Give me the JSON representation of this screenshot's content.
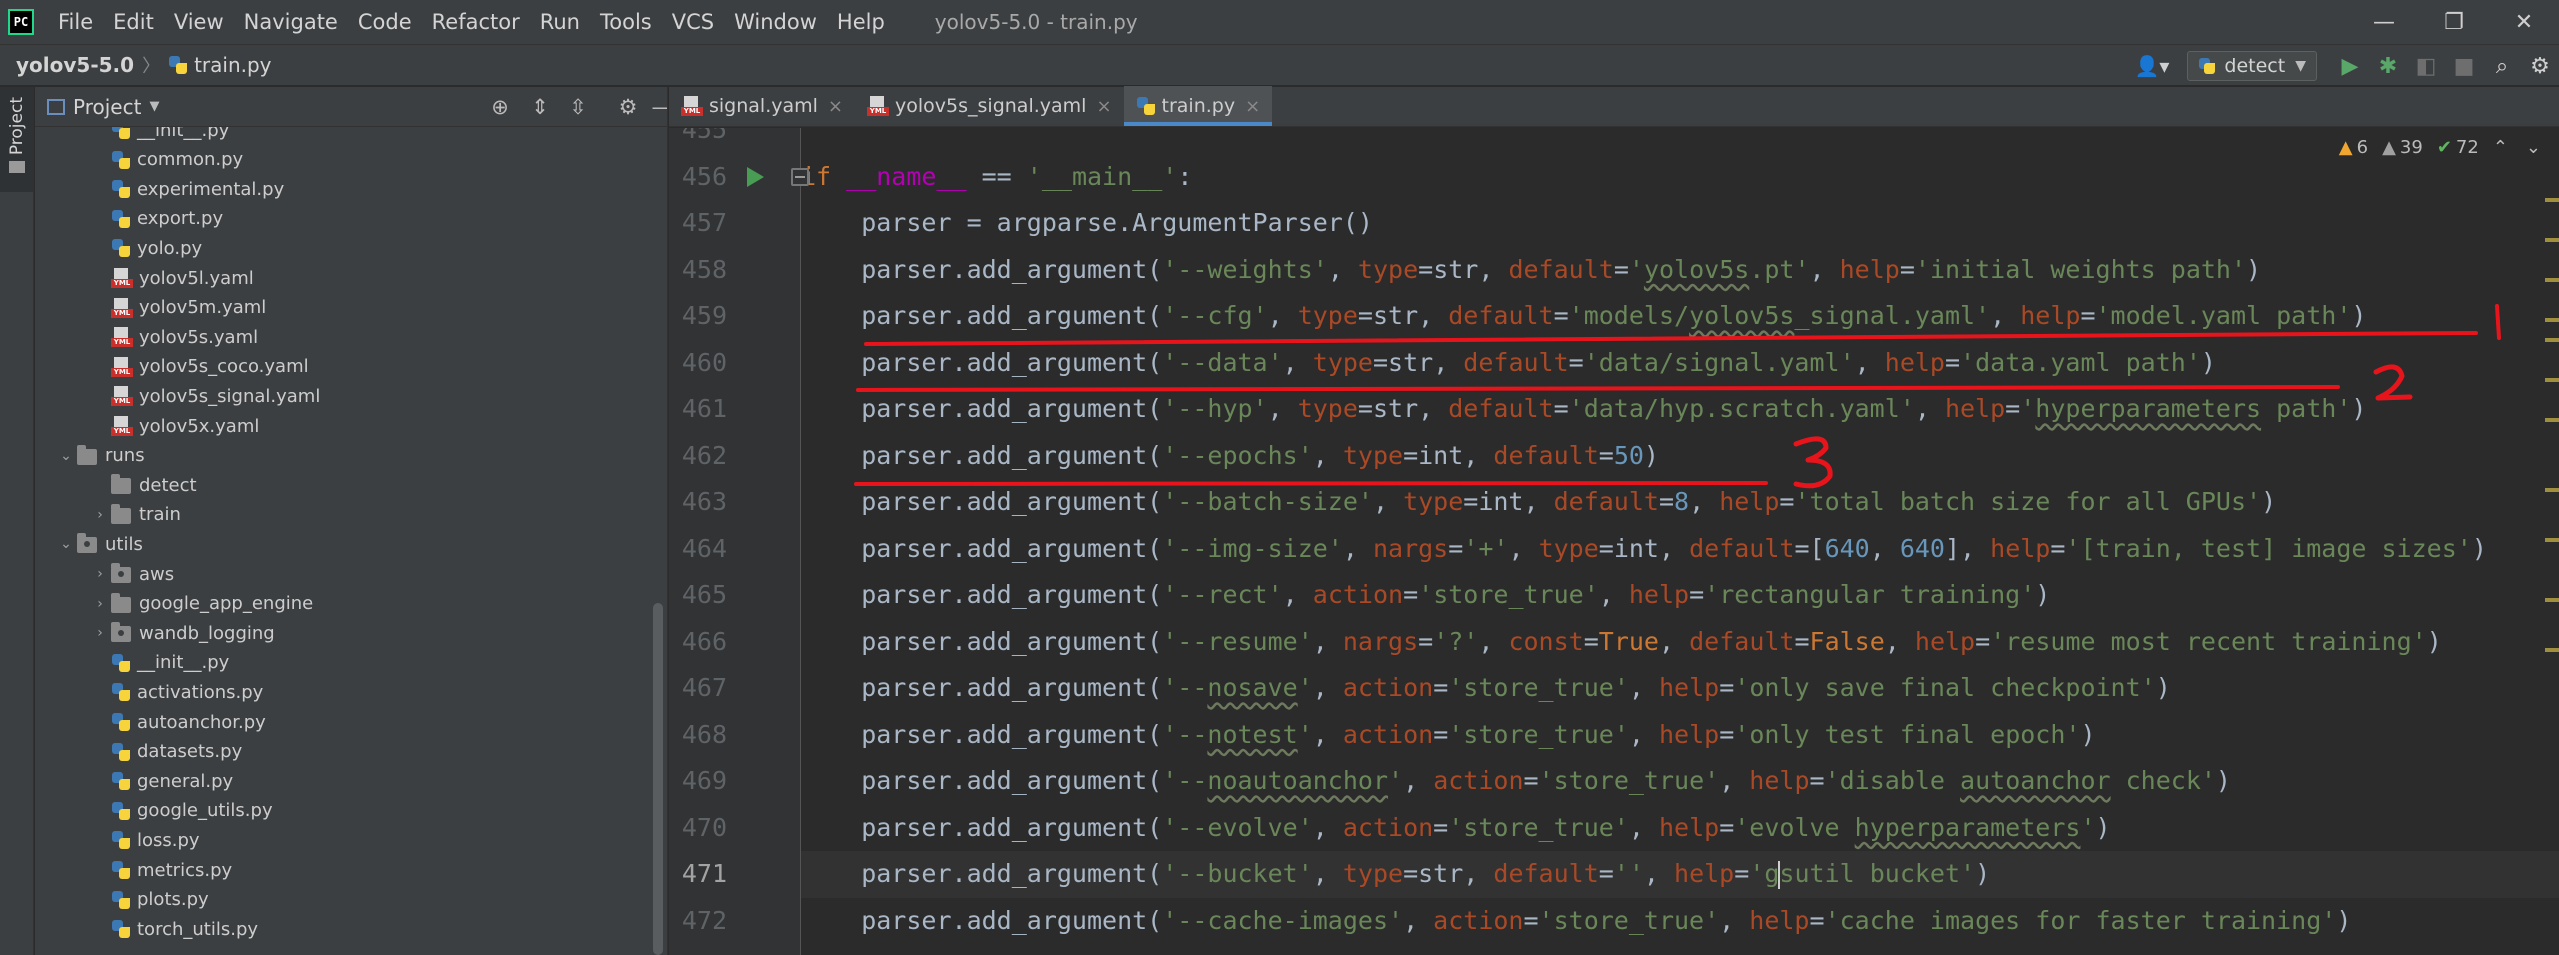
{
  "menubar": {
    "logo": "PC",
    "items": [
      "File",
      "Edit",
      "View",
      "Navigate",
      "Code",
      "Refactor",
      "Run",
      "Tools",
      "VCS",
      "Window",
      "Help"
    ],
    "window_title": "yolov5-5.0 - train.py",
    "minimize_icon": "minimize-icon",
    "maximize_icon": "maximize-icon",
    "close_icon": "close-icon"
  },
  "navbar": {
    "project": "yolov5-5.0",
    "file": "train.py",
    "run_config": "detect"
  },
  "project_panel": {
    "title": "Project",
    "tree": [
      {
        "label": "__init__.py",
        "type": "py",
        "depth": 2
      },
      {
        "label": "common.py",
        "type": "py",
        "depth": 2
      },
      {
        "label": "experimental.py",
        "type": "py",
        "depth": 2
      },
      {
        "label": "export.py",
        "type": "py",
        "depth": 2
      },
      {
        "label": "yolo.py",
        "type": "py",
        "depth": 2
      },
      {
        "label": "yolov5l.yaml",
        "type": "yaml",
        "depth": 2
      },
      {
        "label": "yolov5m.yaml",
        "type": "yaml",
        "depth": 2
      },
      {
        "label": "yolov5s.yaml",
        "type": "yaml",
        "depth": 2
      },
      {
        "label": "yolov5s_coco.yaml",
        "type": "yaml",
        "depth": 2
      },
      {
        "label": "yolov5s_signal.yaml",
        "type": "yaml",
        "depth": 2
      },
      {
        "label": "yolov5x.yaml",
        "type": "yaml",
        "depth": 2
      },
      {
        "label": "runs",
        "type": "folder",
        "depth": 1,
        "chev": "open"
      },
      {
        "label": "detect",
        "type": "folder",
        "depth": 2
      },
      {
        "label": "train",
        "type": "folder",
        "depth": 2,
        "chev": "closed"
      },
      {
        "label": "utils",
        "type": "pkg",
        "depth": 1,
        "chev": "open"
      },
      {
        "label": "aws",
        "type": "pkg",
        "depth": 2,
        "chev": "closed"
      },
      {
        "label": "google_app_engine",
        "type": "folder",
        "depth": 2,
        "chev": "closed"
      },
      {
        "label": "wandb_logging",
        "type": "pkg",
        "depth": 2,
        "chev": "closed"
      },
      {
        "label": "__init__.py",
        "type": "py",
        "depth": 2
      },
      {
        "label": "activations.py",
        "type": "py",
        "depth": 2
      },
      {
        "label": "autoanchor.py",
        "type": "py",
        "depth": 2
      },
      {
        "label": "datasets.py",
        "type": "py",
        "depth": 2
      },
      {
        "label": "general.py",
        "type": "py",
        "depth": 2
      },
      {
        "label": "google_utils.py",
        "type": "py",
        "depth": 2
      },
      {
        "label": "loss.py",
        "type": "py",
        "depth": 2
      },
      {
        "label": "metrics.py",
        "type": "py",
        "depth": 2
      },
      {
        "label": "plots.py",
        "type": "py",
        "depth": 2
      },
      {
        "label": "torch_utils.py",
        "type": "py",
        "depth": 2
      }
    ]
  },
  "editor": {
    "tabs": [
      {
        "label": "signal.yaml",
        "type": "yaml",
        "active": false
      },
      {
        "label": "yolov5s_signal.yaml",
        "type": "yaml",
        "active": false
      },
      {
        "label": "train.py",
        "type": "py",
        "active": true
      }
    ],
    "inspection": {
      "warnings": "6",
      "weak_warnings": "39",
      "ok": "72"
    },
    "first_line": 455,
    "current_line": 471,
    "lines": [
      [],
      [
        [
          "kw",
          "if "
        ],
        [
          "dunder",
          "__name__"
        ],
        [
          "pl",
          " == "
        ],
        [
          "st",
          "'__main__'"
        ],
        [
          "pl",
          ":"
        ]
      ],
      [
        [
          "pl",
          "    parser = argparse.ArgumentParser()"
        ]
      ],
      [
        [
          "pl",
          "    parser.add_argument("
        ],
        [
          "st",
          "'--weights'"
        ],
        [
          "pl",
          ", "
        ],
        [
          "pm",
          "type"
        ],
        [
          "pl",
          "=str, "
        ],
        [
          "pm",
          "default"
        ],
        [
          "pl",
          "="
        ],
        [
          "st",
          "'yolov5s.pt'"
        ],
        [
          "pl",
          ", "
        ],
        [
          "pm",
          "help"
        ],
        [
          "pl",
          "="
        ],
        [
          "st",
          "'initial weights path'"
        ],
        [
          "pl",
          ")"
        ]
      ],
      [
        [
          "pl",
          "    parser.add_argument("
        ],
        [
          "st",
          "'--cfg'"
        ],
        [
          "pl",
          ", "
        ],
        [
          "pm",
          "type"
        ],
        [
          "pl",
          "=str, "
        ],
        [
          "pm",
          "default"
        ],
        [
          "pl",
          "="
        ],
        [
          "st",
          "'models/yolov5s_signal.yaml'"
        ],
        [
          "pl",
          ", "
        ],
        [
          "pm",
          "help"
        ],
        [
          "pl",
          "="
        ],
        [
          "st",
          "'model.yaml path'"
        ],
        [
          "pl",
          ")"
        ]
      ],
      [
        [
          "pl",
          "    parser.add_argument("
        ],
        [
          "st",
          "'--data'"
        ],
        [
          "pl",
          ", "
        ],
        [
          "pm",
          "type"
        ],
        [
          "pl",
          "=str, "
        ],
        [
          "pm",
          "default"
        ],
        [
          "pl",
          "="
        ],
        [
          "st",
          "'data/signal.yaml'"
        ],
        [
          "pl",
          ", "
        ],
        [
          "pm",
          "help"
        ],
        [
          "pl",
          "="
        ],
        [
          "st",
          "'data.yaml path'"
        ],
        [
          "pl",
          ")"
        ]
      ],
      [
        [
          "pl",
          "    parser.add_argument("
        ],
        [
          "st",
          "'--hyp'"
        ],
        [
          "pl",
          ", "
        ],
        [
          "pm",
          "type"
        ],
        [
          "pl",
          "=str, "
        ],
        [
          "pm",
          "default"
        ],
        [
          "pl",
          "="
        ],
        [
          "st",
          "'data/hyp.scratch.yaml'"
        ],
        [
          "pl",
          ", "
        ],
        [
          "pm",
          "help"
        ],
        [
          "pl",
          "="
        ],
        [
          "st",
          "'hyperparameters path'"
        ],
        [
          "pl",
          ")"
        ]
      ],
      [
        [
          "pl",
          "    parser.add_argument("
        ],
        [
          "st",
          "'--epochs'"
        ],
        [
          "pl",
          ", "
        ],
        [
          "pm",
          "type"
        ],
        [
          "pl",
          "=int, "
        ],
        [
          "pm",
          "default"
        ],
        [
          "pl",
          "="
        ],
        [
          "nm",
          "50"
        ],
        [
          "pl",
          ")"
        ]
      ],
      [
        [
          "pl",
          "    parser.add_argument("
        ],
        [
          "st",
          "'--batch-size'"
        ],
        [
          "pl",
          ", "
        ],
        [
          "pm",
          "type"
        ],
        [
          "pl",
          "=int, "
        ],
        [
          "pm",
          "default"
        ],
        [
          "pl",
          "="
        ],
        [
          "nm",
          "8"
        ],
        [
          "pl",
          ", "
        ],
        [
          "pm",
          "help"
        ],
        [
          "pl",
          "="
        ],
        [
          "st",
          "'total batch size for all GPUs'"
        ],
        [
          "pl",
          ")"
        ]
      ],
      [
        [
          "pl",
          "    parser.add_argument("
        ],
        [
          "st",
          "'--img-size'"
        ],
        [
          "pl",
          ", "
        ],
        [
          "pm",
          "nargs"
        ],
        [
          "pl",
          "="
        ],
        [
          "st",
          "'+'"
        ],
        [
          "pl",
          ", "
        ],
        [
          "pm",
          "type"
        ],
        [
          "pl",
          "=int, "
        ],
        [
          "pm",
          "default"
        ],
        [
          "pl",
          "=["
        ],
        [
          "nm",
          "640"
        ],
        [
          "pl",
          ", "
        ],
        [
          "nm",
          "640"
        ],
        [
          "pl",
          "], "
        ],
        [
          "pm",
          "help"
        ],
        [
          "pl",
          "="
        ],
        [
          "st",
          "'[train, test] image sizes'"
        ],
        [
          "pl",
          ")"
        ]
      ],
      [
        [
          "pl",
          "    parser.add_argument("
        ],
        [
          "st",
          "'--rect'"
        ],
        [
          "pl",
          ", "
        ],
        [
          "pm",
          "action"
        ],
        [
          "pl",
          "="
        ],
        [
          "st",
          "'store_true'"
        ],
        [
          "pl",
          ", "
        ],
        [
          "pm",
          "help"
        ],
        [
          "pl",
          "="
        ],
        [
          "st",
          "'rectangular training'"
        ],
        [
          "pl",
          ")"
        ]
      ],
      [
        [
          "pl",
          "    parser.add_argument("
        ],
        [
          "st",
          "'--resume'"
        ],
        [
          "pl",
          ", "
        ],
        [
          "pm",
          "nargs"
        ],
        [
          "pl",
          "="
        ],
        [
          "st",
          "'?'"
        ],
        [
          "pl",
          ", "
        ],
        [
          "pm",
          "const"
        ],
        [
          "pl",
          "="
        ],
        [
          "kw",
          "True"
        ],
        [
          "pl",
          ", "
        ],
        [
          "pm",
          "default"
        ],
        [
          "pl",
          "="
        ],
        [
          "kw",
          "False"
        ],
        [
          "pl",
          ", "
        ],
        [
          "pm",
          "help"
        ],
        [
          "pl",
          "="
        ],
        [
          "st",
          "'resume most recent training'"
        ],
        [
          "pl",
          ")"
        ]
      ],
      [
        [
          "pl",
          "    parser.add_argument("
        ],
        [
          "st",
          "'--nosave'"
        ],
        [
          "pl",
          ", "
        ],
        [
          "pm",
          "action"
        ],
        [
          "pl",
          "="
        ],
        [
          "st",
          "'store_true'"
        ],
        [
          "pl",
          ", "
        ],
        [
          "pm",
          "help"
        ],
        [
          "pl",
          "="
        ],
        [
          "st",
          "'only save final checkpoint'"
        ],
        [
          "pl",
          ")"
        ]
      ],
      [
        [
          "pl",
          "    parser.add_argument("
        ],
        [
          "st",
          "'--notest'"
        ],
        [
          "pl",
          ", "
        ],
        [
          "pm",
          "action"
        ],
        [
          "pl",
          "="
        ],
        [
          "st",
          "'store_true'"
        ],
        [
          "pl",
          ", "
        ],
        [
          "pm",
          "help"
        ],
        [
          "pl",
          "="
        ],
        [
          "st",
          "'only test final epoch'"
        ],
        [
          "pl",
          ")"
        ]
      ],
      [
        [
          "pl",
          "    parser.add_argument("
        ],
        [
          "st",
          "'--noautoanchor'"
        ],
        [
          "pl",
          ", "
        ],
        [
          "pm",
          "action"
        ],
        [
          "pl",
          "="
        ],
        [
          "st",
          "'store_true'"
        ],
        [
          "pl",
          ", "
        ],
        [
          "pm",
          "help"
        ],
        [
          "pl",
          "="
        ],
        [
          "st",
          "'disable autoanchor check'"
        ],
        [
          "pl",
          ")"
        ]
      ],
      [
        [
          "pl",
          "    parser.add_argument("
        ],
        [
          "st",
          "'--evolve'"
        ],
        [
          "pl",
          ", "
        ],
        [
          "pm",
          "action"
        ],
        [
          "pl",
          "="
        ],
        [
          "st",
          "'store_true'"
        ],
        [
          "pl",
          ", "
        ],
        [
          "pm",
          "help"
        ],
        [
          "pl",
          "="
        ],
        [
          "st",
          "'evolve hyperparameters'"
        ],
        [
          "pl",
          ")"
        ]
      ],
      [
        [
          "pl",
          "    parser.add_argument("
        ],
        [
          "st",
          "'--bucket'"
        ],
        [
          "pl",
          ", "
        ],
        [
          "pm",
          "type"
        ],
        [
          "pl",
          "=str, "
        ],
        [
          "pm",
          "default"
        ],
        [
          "pl",
          "="
        ],
        [
          "st",
          "''"
        ],
        [
          "pl",
          ", "
        ],
        [
          "pm",
          "help"
        ],
        [
          "pl",
          "="
        ],
        [
          "st",
          "'g"
        ],
        [
          "caret",
          ""
        ],
        [
          "st",
          "sutil bucket'"
        ],
        [
          "pl",
          ")"
        ]
      ],
      [
        [
          "pl",
          "    parser.add_argument("
        ],
        [
          "st",
          "'--cache-images'"
        ],
        [
          "pl",
          ", "
        ],
        [
          "pm",
          "action"
        ],
        [
          "pl",
          "="
        ],
        [
          "st",
          "'store_true'"
        ],
        [
          "pl",
          ", "
        ],
        [
          "pm",
          "help"
        ],
        [
          "pl",
          "="
        ],
        [
          "st",
          "'cache images for faster training'"
        ],
        [
          "pl",
          ")"
        ]
      ]
    ]
  },
  "annotations": {
    "color": "#e8141c",
    "labels": [
      "1",
      "2",
      "3"
    ]
  }
}
